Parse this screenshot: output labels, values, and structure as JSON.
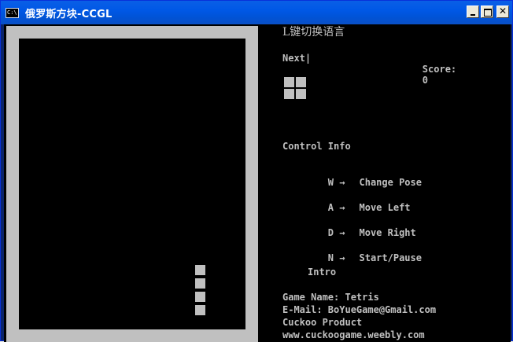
{
  "window": {
    "title": "俄罗斯方块-CCGL",
    "icon_text": "C:\\",
    "buttons": [
      "minimize-icon",
      "maximize-icon",
      "close-icon"
    ],
    "close_symbol": "✕"
  },
  "panel": {
    "language_hint": "L键切换语言",
    "next_label": "Next|",
    "score_label": "Score:",
    "score_value": "0",
    "control_title": "Control Info",
    "controls": [
      {
        "key": "W",
        "arrow": "→",
        "action": "Change Pose"
      },
      {
        "key": "A",
        "arrow": "→",
        "action": "Move Left"
      },
      {
        "key": "D",
        "arrow": "→",
        "action": "Move Right"
      },
      {
        "key": "N",
        "arrow": "→",
        "action": "Start/Pause"
      }
    ],
    "intro_title": "Intro",
    "intro_lines": [
      "Game Name: Tetris",
      "E-Mail: BoYueGame@Gmail.com",
      "Cuckoo Product",
      "www.cuckoogame.weebly.com"
    ]
  },
  "colors": {
    "titlebar": "#0058e6",
    "board_frame": "#c0c0c0",
    "background": "#000000",
    "text": "#c0c0c0"
  },
  "game": {
    "next_piece": "O",
    "falling_piece": "I"
  }
}
